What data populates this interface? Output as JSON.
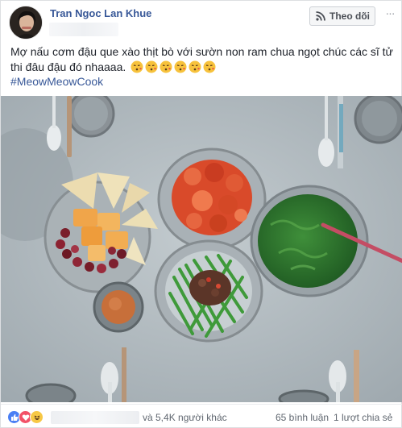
{
  "post": {
    "author_name": "Tran Ngoc Lan Khue",
    "follow_label": "Theo dõi",
    "more_label": "···",
    "text_line1": "Mợ nấu cơm đậu que xào thịt bò với sườn non ram chua ngọt chúc các sĩ tử",
    "text_line2": "thi đâu đậu đó nhaaaa.",
    "hashtag": "#MeowMeowCook"
  },
  "reactions": {
    "icons": [
      "like-icon",
      "love-icon",
      "haha-icon"
    ],
    "count_text": "và 5,4K người khác",
    "comments_text": "65 bình luận",
    "shares_text": "1 lượt chia sẻ"
  },
  "colors": {
    "link_blue": "#385898",
    "like_blue": "#4a7ff4",
    "love_red": "#f25268",
    "haha_yellow": "#f7c845",
    "table_grey": "#b5bec3"
  }
}
